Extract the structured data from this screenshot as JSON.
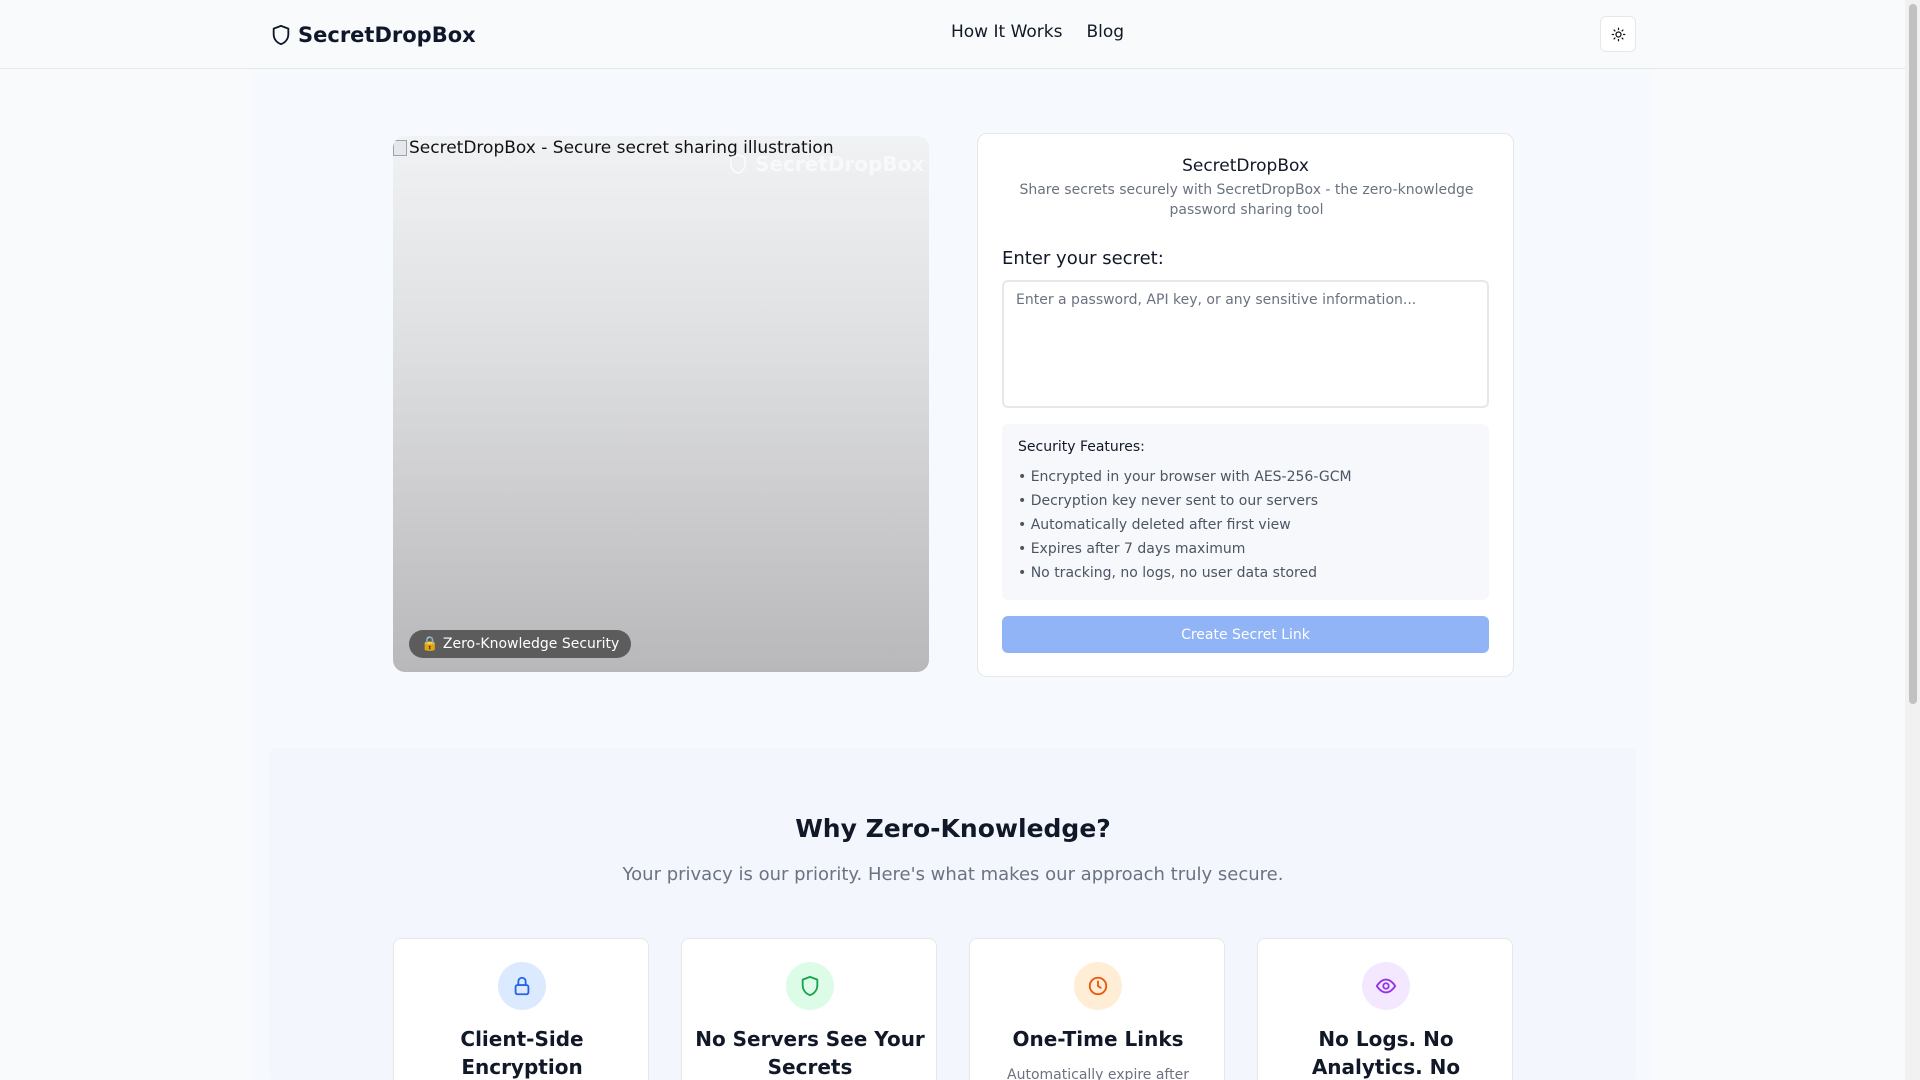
{
  "header": {
    "brand": "SecretDropBox",
    "nav": [
      "How It Works",
      "Blog"
    ],
    "theme_icon": "sun-icon"
  },
  "illustration": {
    "alt_text": "SecretDropBox - Secure secret sharing illustration",
    "watermark": "SecretDropBox",
    "badge": "🔒 Zero-Knowledge Security"
  },
  "form": {
    "title": "SecretDropBox",
    "subtitle": "Share secrets securely with SecretDropBox - the zero-knowledge password sharing tool",
    "label": "Enter your secret:",
    "placeholder": "Enter a password, API key, or any sensitive information...",
    "features_title": "Security Features:",
    "features": [
      "• Encrypted in your browser with AES-256-GCM",
      "• Decryption key never sent to our servers",
      "• Automatically deleted after first view",
      "• Expires after 7 days maximum",
      "• No tracking, no logs, no user data stored"
    ],
    "button": "Create Secret Link"
  },
  "why": {
    "title": "Why Zero-Knowledge?",
    "subtitle": "Your privacy is our priority. Here's what makes our approach truly secure.",
    "cards": [
      {
        "icon": "lock-icon",
        "title": "Client-Side Encryption",
        "desc": "",
        "color": "#2563eb",
        "bg": "#dbeafe"
      },
      {
        "icon": "shield-icon",
        "title": "No Servers See Your Secrets",
        "desc": "",
        "color": "#16a34a",
        "bg": "#dcfce7"
      },
      {
        "icon": "clock-icon",
        "title": "One-Time Links",
        "desc": "Automatically expire after",
        "color": "#ea580c",
        "bg": "#ffedd5"
      },
      {
        "icon": "eye-icon",
        "title": "No Logs. No Analytics. No",
        "desc": "",
        "color": "#9333ea",
        "bg": "#f3e8ff"
      }
    ]
  }
}
